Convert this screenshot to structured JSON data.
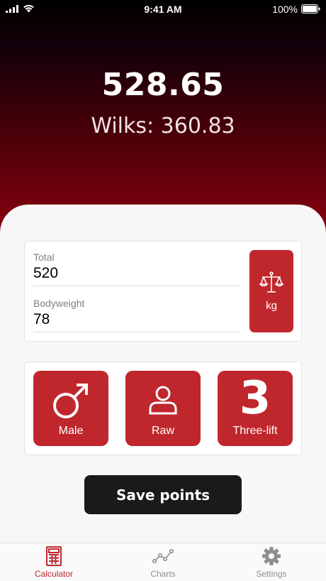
{
  "status_bar": {
    "time": "9:41 AM",
    "battery": "100%"
  },
  "result": {
    "points": "528.65",
    "wilks": "Wilks: 360.83"
  },
  "inputs": {
    "total": {
      "label": "Total",
      "value": "520"
    },
    "bodyweight": {
      "label": "Bodyweight",
      "value": "78"
    },
    "unit": {
      "label": "kg",
      "icon": "scale-icon"
    }
  },
  "options": [
    {
      "label": "Male",
      "icon": "male-symbol-icon"
    },
    {
      "label": "Raw",
      "icon": "person-icon"
    },
    {
      "label": "Three-lift",
      "icon": "number-3-icon",
      "glyph": "3"
    }
  ],
  "save_button": {
    "label": "Save points"
  },
  "tabbar": {
    "tabs": [
      {
        "label": "Calculator",
        "icon": "calculator-icon",
        "active": true
      },
      {
        "label": "Charts",
        "icon": "line-chart-icon",
        "active": false
      },
      {
        "label": "Settings",
        "icon": "gear-icon",
        "active": false
      }
    ]
  },
  "colors": {
    "accent": "#c0272d",
    "hero_top": "#000000",
    "hero_bottom": "#8e0010",
    "button_dark": "#1a1a1a"
  }
}
